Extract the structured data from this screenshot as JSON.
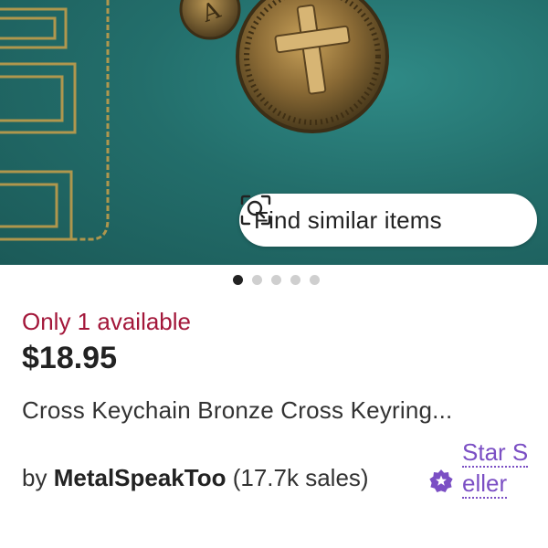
{
  "listing_image": {
    "find_similar_label": "Find similar items",
    "carousel": {
      "count": 5,
      "active_index": 0
    }
  },
  "product": {
    "availability": "Only 1 available",
    "price": "$18.95",
    "title": "Cross Keychain Bronze Cross Keyring..."
  },
  "seller": {
    "by_label": "by",
    "shop_name": "MetalSpeakToo",
    "sales": "(17.7k sales)",
    "badge_icon": "star-seller-badge-icon",
    "badge_color": "#7b4fc4",
    "badge_label": "Star Seller"
  },
  "colors": {
    "availability": "#a3173a",
    "badge": "#7b4fc4"
  }
}
